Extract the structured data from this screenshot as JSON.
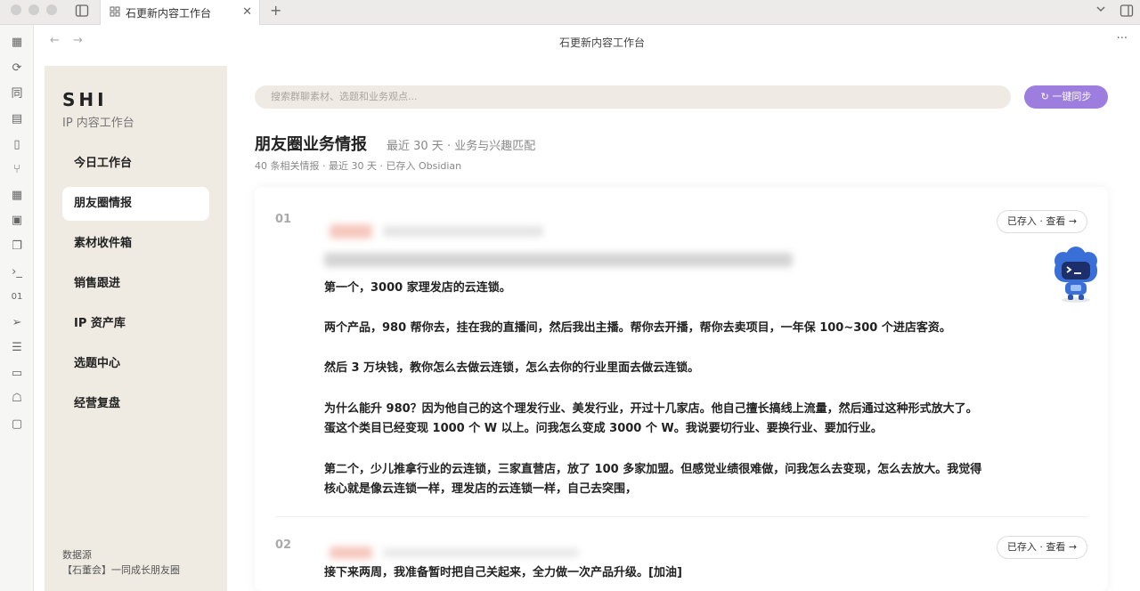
{
  "window": {
    "tab_title": "石更新内容工作台",
    "tab_icon": "grid-icon",
    "nav_title": "石更新内容工作台",
    "more_label": "···"
  },
  "sidebar": {
    "brand": "SHI",
    "subtitle": "IP 内容工作台",
    "items": [
      {
        "label": "今日工作台",
        "active": false
      },
      {
        "label": "朋友圈情报",
        "active": true
      },
      {
        "label": "素材收件箱",
        "active": false
      },
      {
        "label": "销售跟进",
        "active": false
      },
      {
        "label": "IP 资产库",
        "active": false
      },
      {
        "label": "选题中心",
        "active": false
      },
      {
        "label": "经营复盘",
        "active": false
      }
    ],
    "source_label": "数据源",
    "source_value": "【石董会】一同成长朋友圈"
  },
  "search": {
    "placeholder": "搜索群聊素材、选题和业务观点..."
  },
  "sync_button": {
    "label": "↻ 一键同步"
  },
  "page": {
    "title": "朋友圈业务情报",
    "subtitle": "最近 30 天 · 业务与兴趣匹配",
    "meta": "40 条相关情报 · 最近 30 天 · 已存入 Obsidian"
  },
  "entries": [
    {
      "number": "01",
      "saved_label": "已存入 · 查看 →",
      "paragraphs": [
        "第一个，3000 家理发店的云连锁。",
        "两个产品，980 帮你去，挂在我的直播间，然后我出主播。帮你去开播，帮你去卖项目，一年保 100~300 个进店客资。",
        "然后 3 万块钱，教你怎么去做云连锁，怎么去你的行业里面去做云连锁。",
        "为什么能升 980？因为他自己的这个理发行业、美发行业，开过十几家店。他自己擅长搞线上流量，然后通过这种形式放大了。蛋这个类目已经变现 1000 个 W 以上。问我怎么变成 3000 个 W。我说要切行业、要换行业、要加行业。",
        "第二个，少儿推拿行业的云连锁，三家直营店，放了 100 多家加盟。但感觉业绩很难做，问我怎么去变现，怎么去放大。我觉得核心就是像云连锁一样，理发店的云连锁一样，自己去突围，"
      ]
    },
    {
      "number": "02",
      "saved_label": "已存入 · 查看 →",
      "paragraphs": [
        "接下来两周，我准备暂时把自己关起来，全力做一次产品升级。[加油]"
      ]
    }
  ],
  "colors": {
    "accent": "#9d7dde",
    "sidebar_bg": "#efeae2",
    "search_bg": "#efebe4",
    "mascot": "#3b6fd8"
  }
}
